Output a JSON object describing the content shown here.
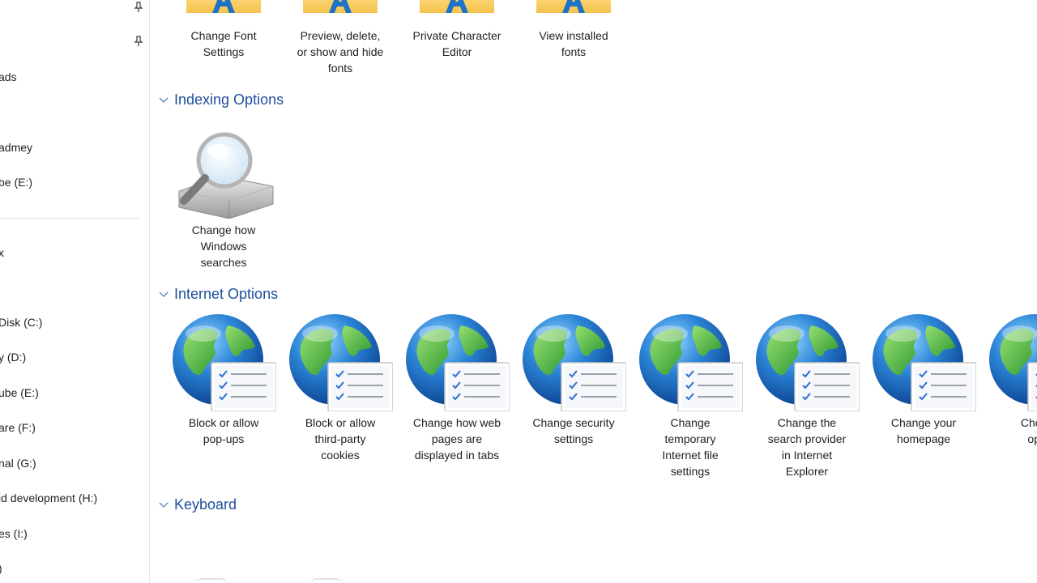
{
  "sidebar": {
    "items": [
      {
        "label": "ads"
      },
      {
        "label": "admey"
      },
      {
        "label": "be (E:)"
      },
      {
        "label": "x"
      },
      {
        "label": "Disk (C:)"
      },
      {
        "label": "y (D:)"
      },
      {
        "label": "ube (E:)"
      },
      {
        "label": "are (F:)"
      },
      {
        "label": "nal (G:)"
      },
      {
        "label": "id development (H:)"
      },
      {
        "label": "es (I:)"
      },
      {
        "label": ")"
      }
    ]
  },
  "fonts_row": {
    "items": [
      {
        "label": "Change Font\nSettings"
      },
      {
        "label": "Preview, delete,\nor show and hide\nfonts"
      },
      {
        "label": "Private Character\nEditor"
      },
      {
        "label": "View installed\nfonts"
      }
    ]
  },
  "indexing": {
    "title": "Indexing Options",
    "items": [
      {
        "label": "Change how\nWindows\nsearches"
      }
    ]
  },
  "internet": {
    "title": "Internet Options",
    "items": [
      {
        "label": "Block or allow\npop-ups"
      },
      {
        "label": "Block or allow\nthird-party\ncookies"
      },
      {
        "label": "Change how web\npages are\ndisplayed in tabs"
      },
      {
        "label": "Change security\nsettings"
      },
      {
        "label": "Change\ntemporary\nInternet file\nsettings"
      },
      {
        "label": "Change the\nsearch provider\nin Internet\nExplorer"
      },
      {
        "label": "Change your\nhomepage"
      },
      {
        "label": "Choose\nopen"
      }
    ]
  },
  "keyboard": {
    "title": "Keyboard"
  },
  "colors": {
    "accent": "#1e4f9a",
    "background": "#ffffff"
  }
}
